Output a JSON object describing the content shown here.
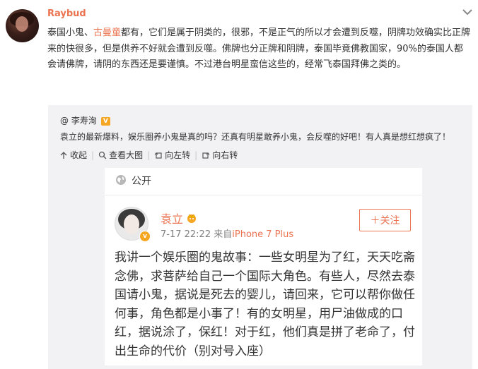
{
  "post": {
    "username": "Raybud",
    "text_pre": "泰国小鬼、",
    "text_link": "古曼童",
    "text_post": "都有，它们是属于阴类的，很邪，不是正气的所以才会遭到反噬，阴牌功效确实比正牌来的快很多，但是供养不好就会遭到反噬。佛牌也分正牌和阴牌，泰国毕竟佛教国家，90%的泰国人都会请佛牌，请阴的东西还是要谨慎。不过港台明星蛮信这些的，经常飞泰国拜佛之类的。"
  },
  "repost": {
    "user": "@ 李寿洵",
    "badge": "V",
    "text": "袁立的最新爆料，娱乐圈养小鬼是真的吗？还真有明星敢养小鬼，会反噬的好吧！有人真是想红想疯了！",
    "tools": [
      "收起",
      "查看大图",
      "向左转",
      "向右转"
    ]
  },
  "card": {
    "visibility": "公开",
    "name": "袁立",
    "vmark": "v",
    "time": "7-17 22:22",
    "from": "来自",
    "source": "iPhone 7 Plus",
    "follow": "＋关注",
    "body": "我讲一个娱乐圈的鬼故事：一些女明星为了红，天天吃斋念佛，求菩萨给自己一个国际大角色。有些人，尽然去泰国请小鬼，据说是死去的婴儿，请回来，它可以帮你做任何事，角色都是小事了！有的女明星，用尸油做成的口红，据说涂了，保红！对于红，他们真是拼了老命了，付出生命的代价（别对号入座）"
  },
  "colors": {
    "accent": "#eb7350",
    "badge": "#f5a623",
    "repost_bg": "#f2f2f5"
  },
  "icons": [
    "chevron-down-icon",
    "collapse-icon",
    "zoom-icon",
    "rotate-left-icon",
    "rotate-right-icon",
    "globe-icon",
    "crown-icon"
  ]
}
